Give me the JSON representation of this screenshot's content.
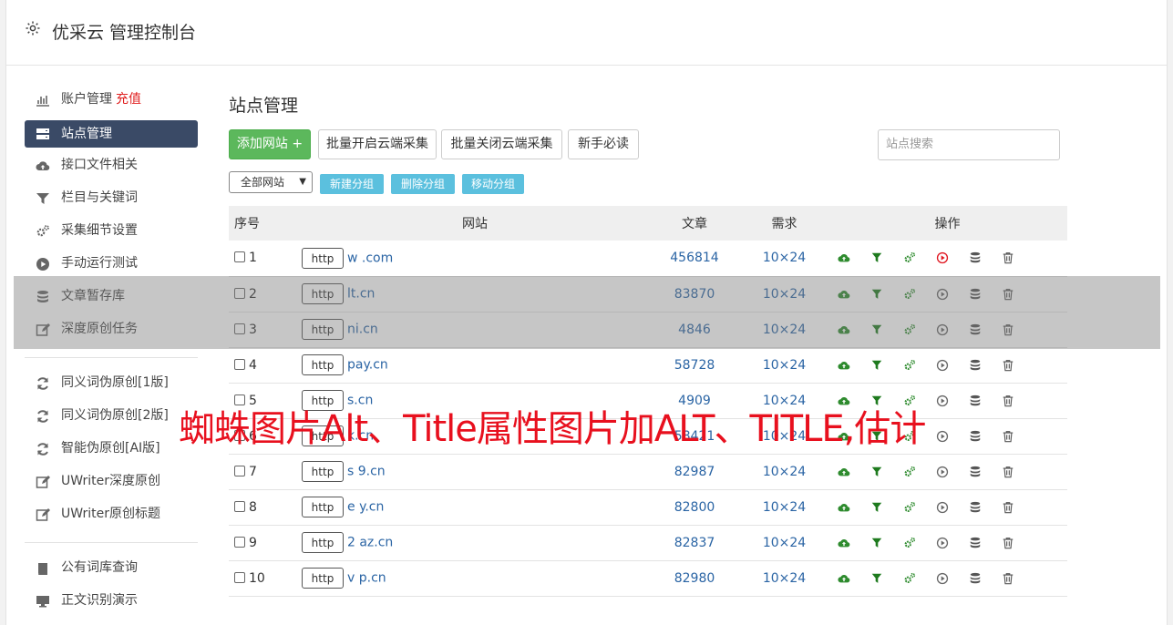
{
  "header": {
    "title": "优采云 管理控制台"
  },
  "sidebar": {
    "groups": [
      [
        {
          "label": "账户管理",
          "badge": "充值",
          "icon": "bar-chart-icon"
        },
        {
          "label": "站点管理",
          "icon": "server-icon",
          "active": true
        },
        {
          "label": "接口文件相关",
          "icon": "cloud-upload-icon"
        },
        {
          "label": "栏目与关键词",
          "icon": "filter-icon"
        },
        {
          "label": "采集细节设置",
          "icon": "gears-icon"
        },
        {
          "label": "手动运行测试",
          "icon": "play-icon"
        },
        {
          "label": "文章暂存库",
          "icon": "database-icon"
        },
        {
          "label": "深度原创任务",
          "icon": "edit-icon"
        }
      ],
      [
        {
          "label": "同义词伪原创[1版]",
          "icon": "refresh-icon"
        },
        {
          "label": "同义词伪原创[2版]",
          "icon": "refresh-icon"
        },
        {
          "label": "智能伪原创[AI版]",
          "icon": "refresh-icon"
        },
        {
          "label": "UWriter深度原创",
          "icon": "edit-icon"
        },
        {
          "label": "UWriter原创标题",
          "icon": "edit-icon"
        }
      ],
      [
        {
          "label": "公有词库查询",
          "icon": "book-icon"
        },
        {
          "label": "正文识别演示",
          "icon": "monitor-icon"
        }
      ]
    ]
  },
  "main": {
    "title": "站点管理",
    "buttons": {
      "add": "添加网站 +",
      "batch_open": "批量开启云端采集",
      "batch_close": "批量关闭云端采集",
      "guide": "新手必读"
    },
    "search_placeholder": "站点搜索",
    "group_select": "全部网站",
    "group_buttons": {
      "new": "新建分组",
      "delete": "删除分组",
      "move": "移动分组"
    },
    "table": {
      "headers": {
        "no": "序号",
        "site": "网站",
        "articles": "文章",
        "demand": "需求",
        "ops": "操作"
      },
      "rows": [
        {
          "no": "1",
          "proto": "http",
          "site": "w         .com",
          "articles": "456814",
          "demand": "10×24",
          "running": true
        },
        {
          "no": "2",
          "proto": "http",
          "site": "lt.cn",
          "articles": "83870",
          "demand": "10×24",
          "running": false
        },
        {
          "no": "3",
          "proto": "http",
          "site": "ni.cn",
          "articles": "4846",
          "demand": "10×24",
          "running": false
        },
        {
          "no": "4",
          "proto": "http",
          "site": "pay.cn",
          "articles": "58728",
          "demand": "10×24",
          "running": false
        },
        {
          "no": "5",
          "proto": "http",
          "site": "s.cn",
          "articles": "4909",
          "demand": "10×24",
          "running": false
        },
        {
          "no": "6",
          "proto": "http",
          "site": "k.cn",
          "articles": "58421",
          "demand": "10×24",
          "running": false
        },
        {
          "no": "7",
          "proto": "http",
          "site": "s   9.cn",
          "articles": "82987",
          "demand": "10×24",
          "running": false
        },
        {
          "no": "8",
          "proto": "http",
          "site": "e    y.cn",
          "articles": "82800",
          "demand": "10×24",
          "running": false
        },
        {
          "no": "9",
          "proto": "http",
          "site": "2    az.cn",
          "articles": "82837",
          "demand": "10×24",
          "running": false
        },
        {
          "no": "10",
          "proto": "http",
          "site": "v    p.cn",
          "articles": "82980",
          "demand": "10×24",
          "running": false
        }
      ]
    }
  },
  "banner": "蜘蛛图片Alt、Title属性图片加ALT、TITLE,估计",
  "colors": {
    "sidebar_active": "#3a4a66",
    "green": "#5cb85c",
    "info": "#5bc0de",
    "link": "#2a64a4",
    "banner": "#e8101e",
    "recharge": "#e02020"
  }
}
